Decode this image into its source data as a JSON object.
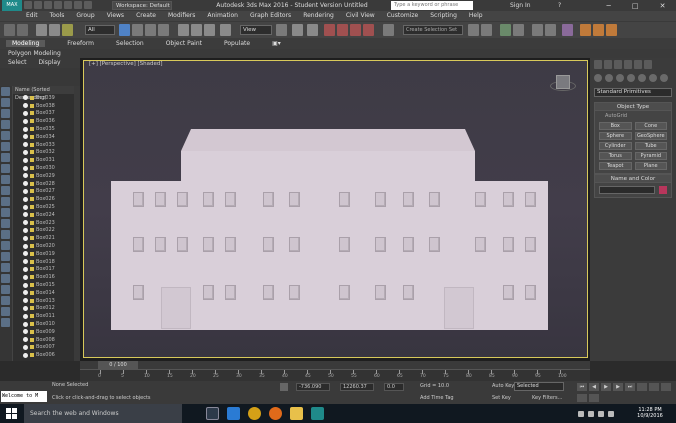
{
  "app": {
    "logo": "MAX",
    "workspace": "Workspace: Default",
    "title": "Autodesk 3ds Max 2016 - Student Version   Untitled",
    "search_placeholder": "Type a keyword or phrase",
    "signin": "Sign In",
    "help": "?"
  },
  "menu": [
    "Edit",
    "Tools",
    "Group",
    "Views",
    "Create",
    "Modifiers",
    "Animation",
    "Graph Editors",
    "Rendering",
    "Civil View",
    "Customize",
    "Scripting",
    "Help"
  ],
  "toolbar": {
    "filter": "All",
    "view": "View",
    "selection_set": "Create Selection Set"
  },
  "ribbon": {
    "tabs": [
      "Modeling",
      "Freeform",
      "Selection",
      "Object Paint",
      "Populate"
    ],
    "active": "Modeling",
    "sub": "Polygon Modeling"
  },
  "scene": {
    "menu": [
      "Select",
      "Display"
    ],
    "header": "Name (Sorted Descending)",
    "items": [
      "Box039",
      "Box038",
      "Box037",
      "Box036",
      "Box035",
      "Box034",
      "Box033",
      "Box032",
      "Box031",
      "Box030",
      "Box029",
      "Box028",
      "Box027",
      "Box026",
      "Box025",
      "Box024",
      "Box023",
      "Box022",
      "Box021",
      "Box020",
      "Box019",
      "Box018",
      "Box017",
      "Box016",
      "Box015",
      "Box014",
      "Box013",
      "Box012",
      "Box011",
      "Box010",
      "Box009",
      "Box008",
      "Box007",
      "Box006"
    ]
  },
  "viewport": {
    "label": "[+] [Perspective] [Shaded]",
    "accent": "#d8c95a"
  },
  "command_panel": {
    "category": "Standard Primitives",
    "object_type_title": "Object Type",
    "autogrid": "AutoGrid",
    "objects": [
      "Box",
      "Cone",
      "Sphere",
      "GeoSphere",
      "Cylinder",
      "Tube",
      "Torus",
      "Pyramid",
      "Teapot",
      "Plane"
    ],
    "name_color_title": "Name and Color",
    "color": "#b8365c"
  },
  "timeline": {
    "frame": "0 / 100",
    "ticks": [
      "0",
      "5",
      "10",
      "15",
      "20",
      "25",
      "30",
      "35",
      "40",
      "45",
      "50",
      "55",
      "60",
      "65",
      "70",
      "75",
      "80",
      "85",
      "90",
      "95",
      "100"
    ]
  },
  "status": {
    "maxscript": "Welcome to M",
    "selection": "None Selected",
    "prompt": "Click or click-and-drag to select objects",
    "x": "-736.090",
    "y": "12260.37",
    "z": "0.0",
    "grid": "Grid = 10.0",
    "add_time_tag": "Add Time Tag",
    "auto_key": "Auto Key",
    "set_key": "Set Key",
    "selected": "Selected",
    "key_filters": "Key Filters..."
  },
  "taskbar": {
    "search": "Search the web and Windows",
    "time": "11:28 PM",
    "date": "10/9/2016"
  }
}
